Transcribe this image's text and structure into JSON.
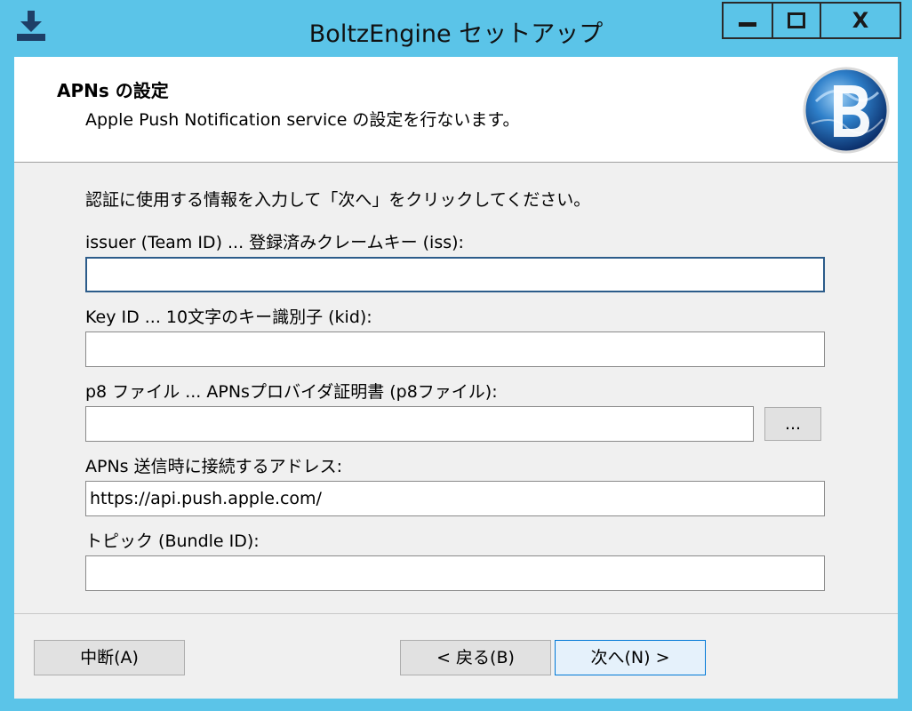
{
  "window": {
    "title": "BoltzEngine セットアップ",
    "close_symbol": "X"
  },
  "header": {
    "title": "APNs の設定",
    "subtitle": "Apple Push Notification service の設定を行ないます。"
  },
  "intro": "認証に使用する情報を入力して「次へ」をクリックしてください。",
  "fields": [
    {
      "label": "issuer (Team ID) ... 登録済みクレームキー (iss):",
      "value": ""
    },
    {
      "label": "Key ID ... 10文字のキー識別子 (kid):",
      "value": ""
    },
    {
      "label": "p8 ファイル ... APNsプロバイダ証明書 (p8ファイル):",
      "value": ""
    },
    {
      "label": "APNs 送信時に接続するアドレス:",
      "value": "https://api.push.apple.com/"
    },
    {
      "label": "トピック (Bundle ID):",
      "value": ""
    }
  ],
  "browse_label": "...",
  "buttons": {
    "cancel": "中断(A)",
    "back": "< 戻る(B)",
    "next": "次へ(N) >"
  },
  "colors": {
    "title_bar": "#5bc4e8",
    "dialog_bg": "#f0f0f0",
    "focus_border": "#2c5c8a"
  }
}
